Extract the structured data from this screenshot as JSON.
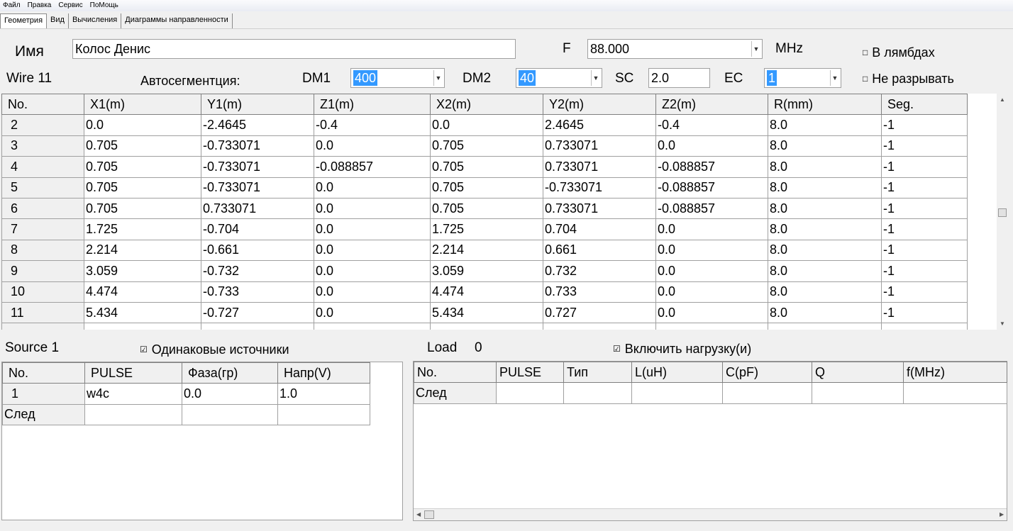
{
  "menu": [
    "Файл",
    "Правка",
    "Сервис",
    "ПоМощь"
  ],
  "tabs": [
    "Геометрия",
    "Вид",
    "Вычисления",
    "Диаграммы направленности"
  ],
  "name_label": "Имя",
  "name_value": "Колос Денис",
  "freq_label": "F",
  "freq_value": "88.000",
  "freq_unit": "MHz",
  "lambda_check": {
    "label": "В лямбдах",
    "checked": false
  },
  "nobreak_check": {
    "label": "Не разрывать",
    "checked": false
  },
  "wire_label": "Wire 11",
  "autoseg_label": "Автосегментция:",
  "dm1_label": "DM1",
  "dm1_value": "400",
  "dm2_label": "DM2",
  "dm2_value": "40",
  "sc_label": "SC",
  "sc_value": "2.0",
  "ec_label": "EC",
  "ec_value": "1",
  "wire_table": {
    "headers": [
      "No.",
      "X1(m)",
      "Y1(m)",
      "Z1(m)",
      "X2(m)",
      "Y2(m)",
      "Z2(m)",
      "R(mm)",
      "Seg."
    ],
    "rows": [
      [
        "2",
        "0.0",
        "-2.4645",
        "-0.4",
        "0.0",
        "2.4645",
        "-0.4",
        "8.0",
        "-1"
      ],
      [
        "3",
        "0.705",
        "-0.733071",
        "0.0",
        "0.705",
        "0.733071",
        "0.0",
        "8.0",
        "-1"
      ],
      [
        "4",
        "0.705",
        "-0.733071",
        "-0.088857",
        "0.705",
        "0.733071",
        "-0.088857",
        "8.0",
        "-1"
      ],
      [
        "5",
        "0.705",
        "-0.733071",
        "0.0",
        "0.705",
        "-0.733071",
        "-0.088857",
        "8.0",
        "-1"
      ],
      [
        "6",
        "0.705",
        "0.733071",
        "0.0",
        "0.705",
        "0.733071",
        "-0.088857",
        "8.0",
        "-1"
      ],
      [
        "7",
        "1.725",
        "-0.704",
        "0.0",
        "1.725",
        "0.704",
        "0.0",
        "8.0",
        "-1"
      ],
      [
        "8",
        "2.214",
        "-0.661",
        "0.0",
        "2.214",
        "0.661",
        "0.0",
        "8.0",
        "-1"
      ],
      [
        "9",
        "3.059",
        "-0.732",
        "0.0",
        "3.059",
        "0.732",
        "0.0",
        "8.0",
        "-1"
      ],
      [
        "10",
        "4.474",
        "-0.733",
        "0.0",
        "4.474",
        "0.733",
        "0.0",
        "8.0",
        "-1"
      ],
      [
        "11",
        "5.434",
        "-0.727",
        "0.0",
        "5.434",
        "0.727",
        "0.0",
        "8.0",
        "-1"
      ]
    ]
  },
  "source_label": "Source 1",
  "same_sources_check": {
    "label": "Одинаковые источники",
    "checked": true
  },
  "source_table": {
    "headers": [
      "No.",
      "PULSE",
      "Фаза(гр)",
      "Напр(V)"
    ],
    "rows": [
      [
        "1",
        "w4c",
        "0.0",
        "1.0"
      ]
    ],
    "next_label": "След"
  },
  "load_label": "Load",
  "load_count": "0",
  "include_load_check": {
    "label": "Включить нагрузку(и)",
    "checked": true
  },
  "load_table": {
    "headers": [
      "No.",
      "PULSE",
      "Тип",
      "L(uH)",
      "C(pF)",
      "Q",
      "f(MHz)"
    ],
    "next_label": "След"
  },
  "colors": {
    "selection": "#3399ff",
    "background": "#f0f0f0"
  }
}
